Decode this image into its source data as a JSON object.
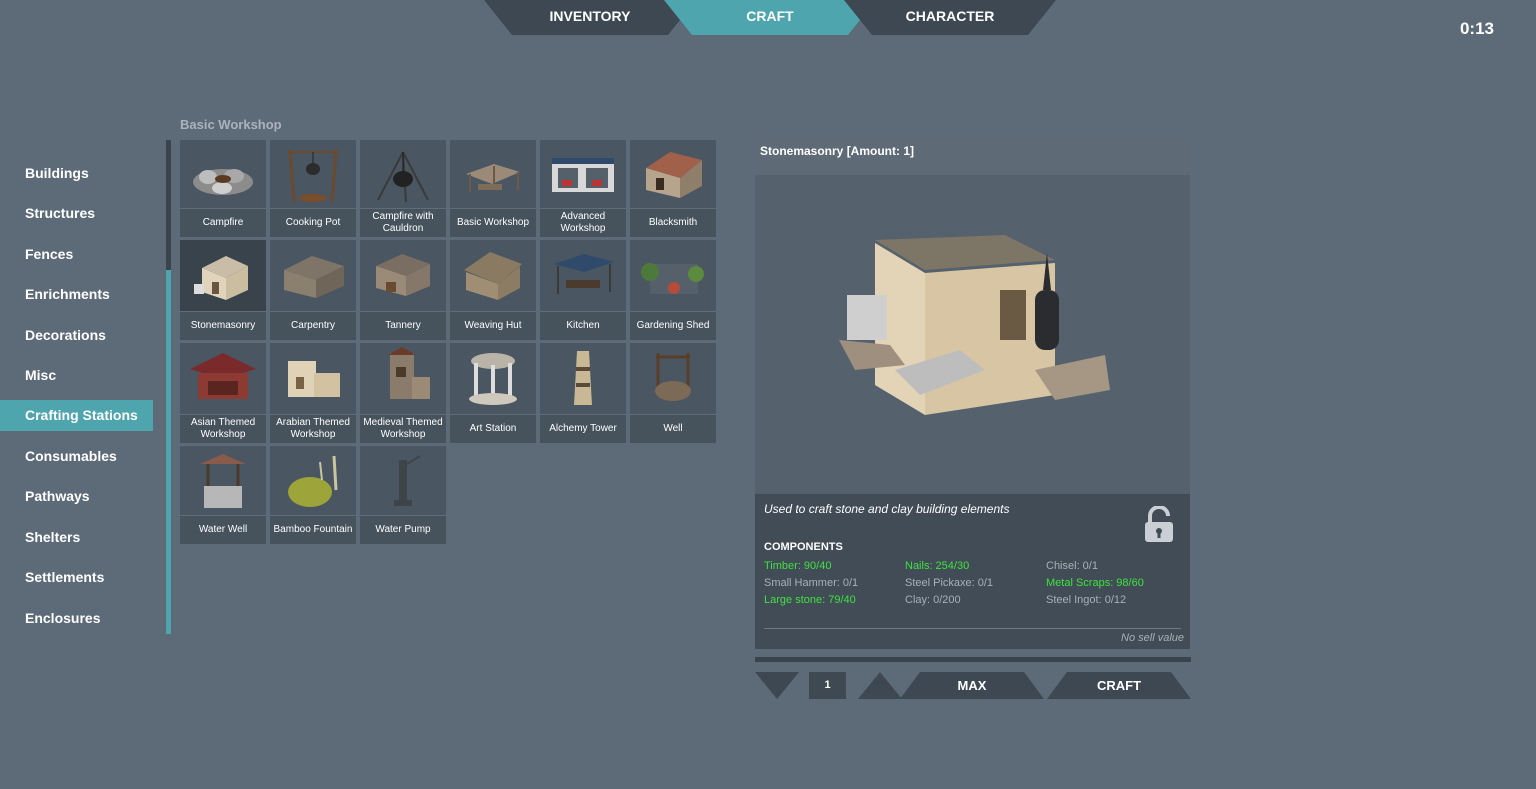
{
  "tabs": [
    "INVENTORY",
    "CRAFT",
    "CHARACTER"
  ],
  "timer": "0:13",
  "categories": [
    "Buildings",
    "Structures",
    "Fences",
    "Enrichments",
    "Decorations",
    "Misc",
    "Crafting Stations",
    "Consumables",
    "Pathways",
    "Shelters",
    "Settlements",
    "Enclosures"
  ],
  "active_category": "Crafting Stations",
  "section_title": "Basic Workshop",
  "items": [
    "Campfire",
    "Cooking Pot",
    "Campfire with Cauldron",
    "Basic Workshop",
    "Advanced Workshop",
    "Blacksmith",
    "Stonemasonry",
    "Carpentry",
    "Tannery",
    "Weaving Hut",
    "Kitchen",
    "Gardening Shed",
    "Asian Themed Workshop",
    "Arabian Themed Workshop",
    "Medieval Themed Workshop",
    "Art Station",
    "Alchemy Tower",
    "Well",
    "Water Well",
    "Bamboo Fountain",
    "Water Pump"
  ],
  "selected_item": "Stonemasonry",
  "detail": {
    "title": "Stonemasonry [Amount: 1]",
    "description": "Used to craft stone and clay building elements",
    "components_title": "COMPONENTS",
    "components": [
      {
        "text": "Timber: 90/40",
        "ok": true
      },
      {
        "text": "Nails: 254/30",
        "ok": true
      },
      {
        "text": "Chisel: 0/1",
        "ok": false
      },
      {
        "text": "Small Hammer: 0/1",
        "ok": false
      },
      {
        "text": "Steel Pickaxe: 0/1",
        "ok": false
      },
      {
        "text": "Metal Scraps: 98/60",
        "ok": true
      },
      {
        "text": "Large stone: 79/40",
        "ok": true
      },
      {
        "text": "Clay: 0/200",
        "ok": false
      },
      {
        "text": "Steel Ingot: 0/12",
        "ok": false
      }
    ],
    "sell_value": "No sell value"
  },
  "controls": {
    "quantity": "1",
    "max_label": "MAX",
    "craft_label": "CRAFT"
  },
  "colors": {
    "background": "#5d6b78",
    "accent": "#4ea5ad",
    "ok": "#3ee23e",
    "panel": "#55626e"
  }
}
